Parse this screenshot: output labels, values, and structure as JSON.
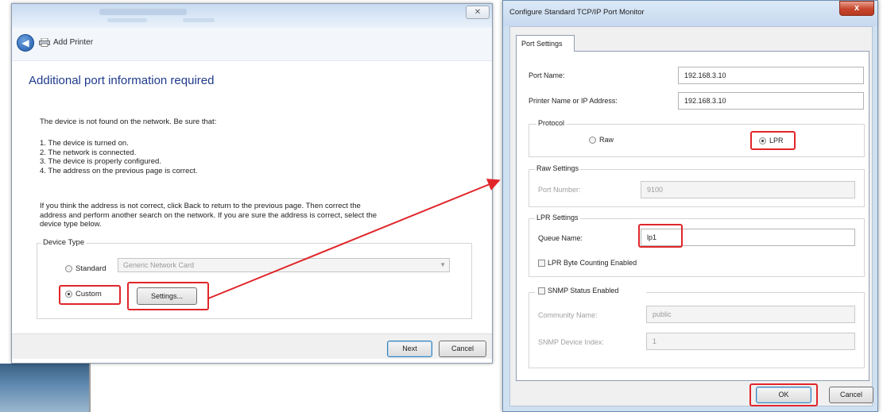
{
  "wizard": {
    "nav_title": "Add Printer",
    "close_label": "✕",
    "heading": "Additional port information required",
    "intro": "The device is not found on the network.  Be sure that:",
    "list": [
      "1.  The device is turned on.",
      "2.  The network is connected.",
      "3.  The device is properly configured.",
      "4.  The address on the previous page is correct."
    ],
    "paragraph_lines": [
      "If you think the address is not correct, click Back to return to the previous page.  Then correct the",
      "address and perform another search on the network.  If you are sure the address is correct, select the",
      "device type below."
    ],
    "device_type_legend": "Device Type",
    "standard_label": "Standard",
    "standard_value": "Generic Network Card",
    "custom_label": "Custom",
    "settings_button": "Settings...",
    "next_button": "Next",
    "cancel_button": "Cancel"
  },
  "dialog": {
    "title": "Configure Standard TCP/IP Port Monitor",
    "close_label": "x",
    "tab_label": "Port Settings",
    "port_name_label": "Port Name:",
    "port_name_value": "192.168.3.10",
    "printer_name_label": "Printer Name or IP Address:",
    "printer_name_value": "192.168.3.10",
    "protocol_legend": "Protocol",
    "raw_label": "Raw",
    "lpr_label": "LPR",
    "raw_settings_legend": "Raw Settings",
    "port_number_label": "Port Number:",
    "port_number_value": "9100",
    "lpr_settings_legend": "LPR Settings",
    "queue_name_label": "Queue Name:",
    "queue_name_value": "lp1",
    "lpr_byte_counting_label": "LPR Byte Counting Enabled",
    "snmp_label": "SNMP Status Enabled",
    "community_name_label": "Community Name:",
    "community_name_value": "public",
    "snmp_index_label": "SNMP Device Index:",
    "snmp_index_value": "1",
    "ok_button": "OK",
    "cancel_button": "Cancel"
  },
  "colors": {
    "annotation_red": "#e0262a",
    "heading_blue": "#1e3a8c"
  },
  "icons": {
    "back": "back-arrow-icon",
    "printer": "printer-icon"
  }
}
